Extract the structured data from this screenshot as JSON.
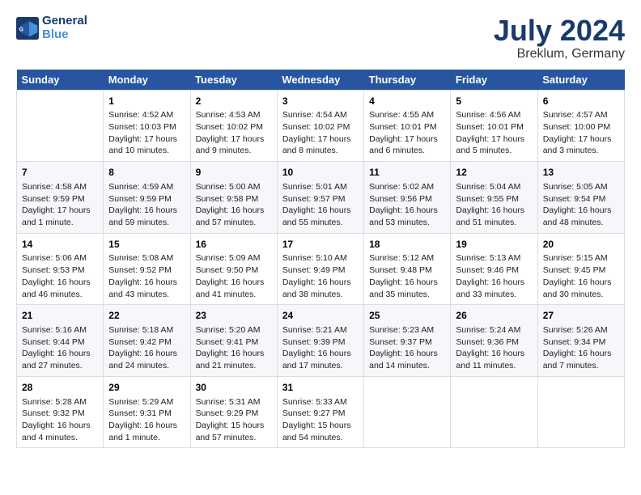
{
  "header": {
    "logo_line1": "General",
    "logo_line2": "Blue",
    "title": "July 2024",
    "subtitle": "Breklum, Germany"
  },
  "days_of_week": [
    "Sunday",
    "Monday",
    "Tuesday",
    "Wednesday",
    "Thursday",
    "Friday",
    "Saturday"
  ],
  "weeks": [
    [
      {
        "day": "",
        "content": ""
      },
      {
        "day": "1",
        "content": "Sunrise: 4:52 AM\nSunset: 10:03 PM\nDaylight: 17 hours\nand 10 minutes."
      },
      {
        "day": "2",
        "content": "Sunrise: 4:53 AM\nSunset: 10:02 PM\nDaylight: 17 hours\nand 9 minutes."
      },
      {
        "day": "3",
        "content": "Sunrise: 4:54 AM\nSunset: 10:02 PM\nDaylight: 17 hours\nand 8 minutes."
      },
      {
        "day": "4",
        "content": "Sunrise: 4:55 AM\nSunset: 10:01 PM\nDaylight: 17 hours\nand 6 minutes."
      },
      {
        "day": "5",
        "content": "Sunrise: 4:56 AM\nSunset: 10:01 PM\nDaylight: 17 hours\nand 5 minutes."
      },
      {
        "day": "6",
        "content": "Sunrise: 4:57 AM\nSunset: 10:00 PM\nDaylight: 17 hours\nand 3 minutes."
      }
    ],
    [
      {
        "day": "7",
        "content": "Sunrise: 4:58 AM\nSunset: 9:59 PM\nDaylight: 17 hours\nand 1 minute."
      },
      {
        "day": "8",
        "content": "Sunrise: 4:59 AM\nSunset: 9:59 PM\nDaylight: 16 hours\nand 59 minutes."
      },
      {
        "day": "9",
        "content": "Sunrise: 5:00 AM\nSunset: 9:58 PM\nDaylight: 16 hours\nand 57 minutes."
      },
      {
        "day": "10",
        "content": "Sunrise: 5:01 AM\nSunset: 9:57 PM\nDaylight: 16 hours\nand 55 minutes."
      },
      {
        "day": "11",
        "content": "Sunrise: 5:02 AM\nSunset: 9:56 PM\nDaylight: 16 hours\nand 53 minutes."
      },
      {
        "day": "12",
        "content": "Sunrise: 5:04 AM\nSunset: 9:55 PM\nDaylight: 16 hours\nand 51 minutes."
      },
      {
        "day": "13",
        "content": "Sunrise: 5:05 AM\nSunset: 9:54 PM\nDaylight: 16 hours\nand 48 minutes."
      }
    ],
    [
      {
        "day": "14",
        "content": "Sunrise: 5:06 AM\nSunset: 9:53 PM\nDaylight: 16 hours\nand 46 minutes."
      },
      {
        "day": "15",
        "content": "Sunrise: 5:08 AM\nSunset: 9:52 PM\nDaylight: 16 hours\nand 43 minutes."
      },
      {
        "day": "16",
        "content": "Sunrise: 5:09 AM\nSunset: 9:50 PM\nDaylight: 16 hours\nand 41 minutes."
      },
      {
        "day": "17",
        "content": "Sunrise: 5:10 AM\nSunset: 9:49 PM\nDaylight: 16 hours\nand 38 minutes."
      },
      {
        "day": "18",
        "content": "Sunrise: 5:12 AM\nSunset: 9:48 PM\nDaylight: 16 hours\nand 35 minutes."
      },
      {
        "day": "19",
        "content": "Sunrise: 5:13 AM\nSunset: 9:46 PM\nDaylight: 16 hours\nand 33 minutes."
      },
      {
        "day": "20",
        "content": "Sunrise: 5:15 AM\nSunset: 9:45 PM\nDaylight: 16 hours\nand 30 minutes."
      }
    ],
    [
      {
        "day": "21",
        "content": "Sunrise: 5:16 AM\nSunset: 9:44 PM\nDaylight: 16 hours\nand 27 minutes."
      },
      {
        "day": "22",
        "content": "Sunrise: 5:18 AM\nSunset: 9:42 PM\nDaylight: 16 hours\nand 24 minutes."
      },
      {
        "day": "23",
        "content": "Sunrise: 5:20 AM\nSunset: 9:41 PM\nDaylight: 16 hours\nand 21 minutes."
      },
      {
        "day": "24",
        "content": "Sunrise: 5:21 AM\nSunset: 9:39 PM\nDaylight: 16 hours\nand 17 minutes."
      },
      {
        "day": "25",
        "content": "Sunrise: 5:23 AM\nSunset: 9:37 PM\nDaylight: 16 hours\nand 14 minutes."
      },
      {
        "day": "26",
        "content": "Sunrise: 5:24 AM\nSunset: 9:36 PM\nDaylight: 16 hours\nand 11 minutes."
      },
      {
        "day": "27",
        "content": "Sunrise: 5:26 AM\nSunset: 9:34 PM\nDaylight: 16 hours\nand 7 minutes."
      }
    ],
    [
      {
        "day": "28",
        "content": "Sunrise: 5:28 AM\nSunset: 9:32 PM\nDaylight: 16 hours\nand 4 minutes."
      },
      {
        "day": "29",
        "content": "Sunrise: 5:29 AM\nSunset: 9:31 PM\nDaylight: 16 hours\nand 1 minute."
      },
      {
        "day": "30",
        "content": "Sunrise: 5:31 AM\nSunset: 9:29 PM\nDaylight: 15 hours\nand 57 minutes."
      },
      {
        "day": "31",
        "content": "Sunrise: 5:33 AM\nSunset: 9:27 PM\nDaylight: 15 hours\nand 54 minutes."
      },
      {
        "day": "",
        "content": ""
      },
      {
        "day": "",
        "content": ""
      },
      {
        "day": "",
        "content": ""
      }
    ]
  ]
}
